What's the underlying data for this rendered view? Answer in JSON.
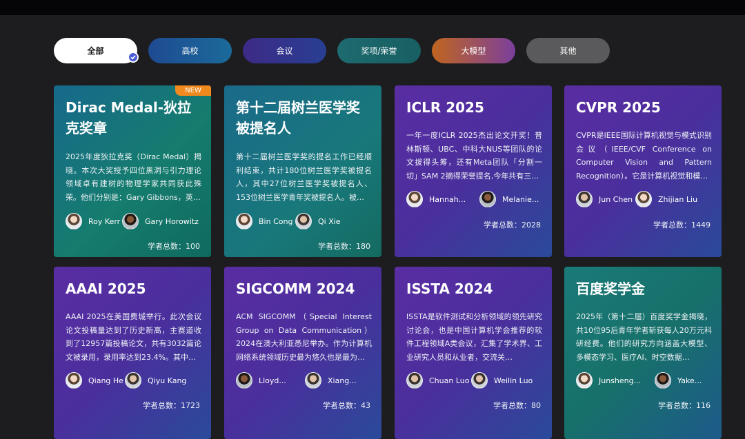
{
  "filters": [
    {
      "label": "全部"
    },
    {
      "label": "高校"
    },
    {
      "label": "会议"
    },
    {
      "label": "奖项/荣誉"
    },
    {
      "label": "大模型"
    },
    {
      "label": "其他"
    }
  ],
  "cards": [
    {
      "title": "Dirac Medal-狄拉克奖章",
      "badge": "NEW",
      "desc": "2025年度狄拉克奖（Dirac Medal）揭晓。本次大奖授予四位黑洞与引力理论领域卓有建树的物理学家共同获此殊荣。他们分别是：Gary Gibbons，英…",
      "people": [
        "Roy Kerr",
        "Gary Horowitz"
      ],
      "count": "学者总数：100"
    },
    {
      "title": "第十二届树兰医学奖被提名人",
      "desc": "第十二届树兰医学奖的提名工作已经顺利结束，共计180位树兰医学奖被提名人，其中27位树兰医学奖被提名人、153位树兰医学青年奖被提名人。被…",
      "people": [
        "Bin Cong",
        "Qi Xie"
      ],
      "count": "学者总数：180"
    },
    {
      "title": "ICLR 2025",
      "desc": "一年一度ICLR 2025杰出论文开奖！普林斯顿、UBC、中科大NUS等团队的论文拔得头筹，还有Meta团队「分割一切」SAM 2摘得荣誉提名,今年共有三…",
      "people": [
        "Hannah...",
        "Melanie..."
      ],
      "count": "学者总数：2028"
    },
    {
      "title": "CVPR 2025",
      "desc": "CVPR是IEEE国际计算机视觉与模式识别会议（IEEE/CVF Conference on Computer Vision and Pattern Recognition）。它是计算机视觉和模…",
      "people": [
        "Jun Chen",
        "Zhijian Liu"
      ],
      "count": "学者总数：1449"
    },
    {
      "title": "AAAI 2025",
      "desc": "AAAI 2025在美国费城举行。此次会议论文投稿量达到了历史新高，主赛道收到了12957篇投稿论文，共有3032篇论文被录用，录用率达到23.4%。其中…",
      "people": [
        "Qiang He",
        "Qiyu Kang"
      ],
      "count": "学者总数：1723"
    },
    {
      "title": "SIGCOMM 2024",
      "desc": "ACM SIGCOMM（Special Interest Group on Data Communication）2024在澳大利亚悉尼举办。作为计算机网络系统领域历史最为悠久也是最为…",
      "people": [
        "Lloyd...",
        "Xiang..."
      ],
      "count": "学者总数：43"
    },
    {
      "title": "ISSTA 2024",
      "desc": "ISSTA是软件测试和分析领域的领先研究讨论会，也是中国计算机学会推荐的软件工程领域A类会议，汇集了学术界、工业研究人员和从业者，交流关…",
      "people": [
        "Chuan Luo",
        "Weilin Luo"
      ],
      "count": "学者总数：80"
    },
    {
      "title": "百度奖学金",
      "desc": "2025年（第十二届）百度奖学金揭晓，共10位95后青年学者斩获每人20万元科研经费。他们的研究方向涵盖大模型、多模态学习、医疗AI、时空数据…",
      "people": [
        "Junsheng...",
        "Yake..."
      ],
      "count": "学者总数：116"
    }
  ]
}
